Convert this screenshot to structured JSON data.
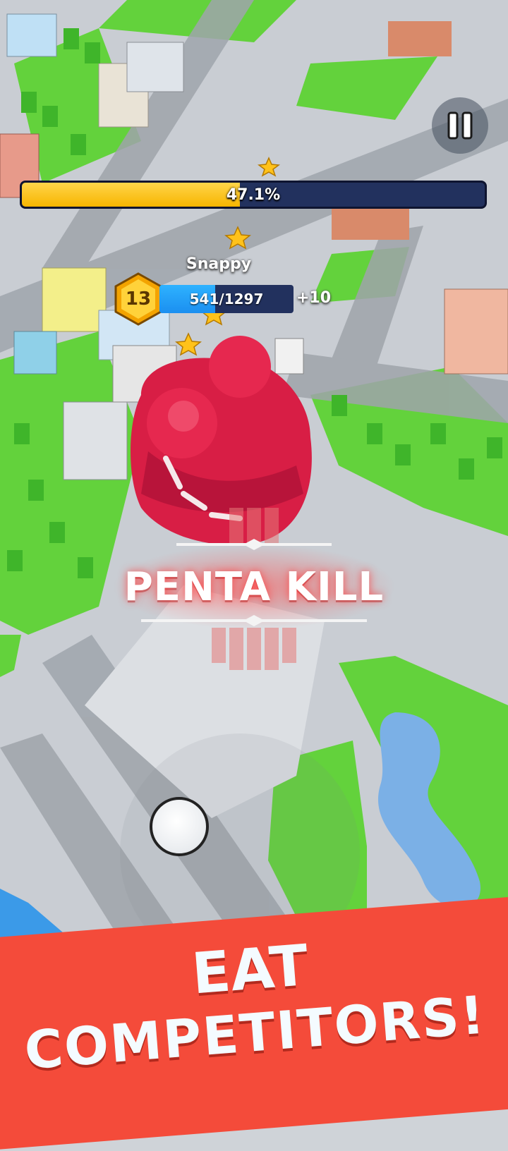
{
  "hud": {
    "pause_icon": "pause-icon",
    "map_progress": {
      "percent": 47.1,
      "label": "47.1%"
    },
    "player": {
      "name": "Snappy",
      "level": "13",
      "xp_label": "541/1297",
      "xp_fraction": 0.417,
      "score_gain": "+10"
    }
  },
  "event": {
    "kill_text": "PENTA KILL"
  },
  "promo": {
    "line1": "EAT",
    "line2": "COMPETITORS!"
  },
  "colors": {
    "progress_fill": "#f7b500",
    "progress_track": "#22315e",
    "xp_fill": "#1b8ff0",
    "promo_banner": "#f44b3a",
    "monster": "#d81e45",
    "grass": "#5fd13a",
    "road": "#b8bcc2"
  },
  "icons": [
    "pause-icon",
    "star-icon",
    "level-badge-icon",
    "joystick-knob"
  ]
}
